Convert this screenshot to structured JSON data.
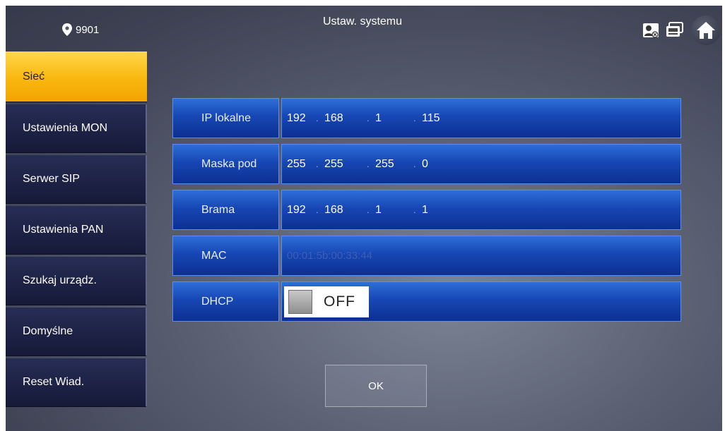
{
  "header": {
    "title": "Ustaw. systemu",
    "location": "9901"
  },
  "icons": {
    "location": "map-pin-icon",
    "contact": "contact-card-icon",
    "monitor": "monitor-icon",
    "home": "home-icon"
  },
  "sidebar": {
    "items": [
      {
        "label": "Sieć",
        "active": true
      },
      {
        "label": "Ustawienia MON"
      },
      {
        "label": "Serwer SIP"
      },
      {
        "label": "Ustawienia PAN"
      },
      {
        "label": "Szukaj urządz."
      },
      {
        "label": "Domyślne"
      },
      {
        "label": "Reset Wiad."
      }
    ]
  },
  "form": {
    "local_ip": {
      "label": "IP lokalne",
      "octets": [
        "192",
        "168",
        "1",
        "115"
      ]
    },
    "subnet_mask": {
      "label": "Maska pod",
      "octets": [
        "255",
        "255",
        "255",
        "0"
      ]
    },
    "gateway": {
      "label": "Brama",
      "octets": [
        "192",
        "168",
        "1",
        "1"
      ]
    },
    "mac": {
      "label": "MAC",
      "value": "00:01:5b:00:33:44"
    },
    "dhcp": {
      "label": "DHCP",
      "state": "OFF"
    },
    "ip_separator": "."
  },
  "buttons": {
    "ok": "OK"
  },
  "colors": {
    "active_tab": "#f9b70f",
    "field_blue": "#1747b4",
    "sidebar": "#1e2347"
  }
}
